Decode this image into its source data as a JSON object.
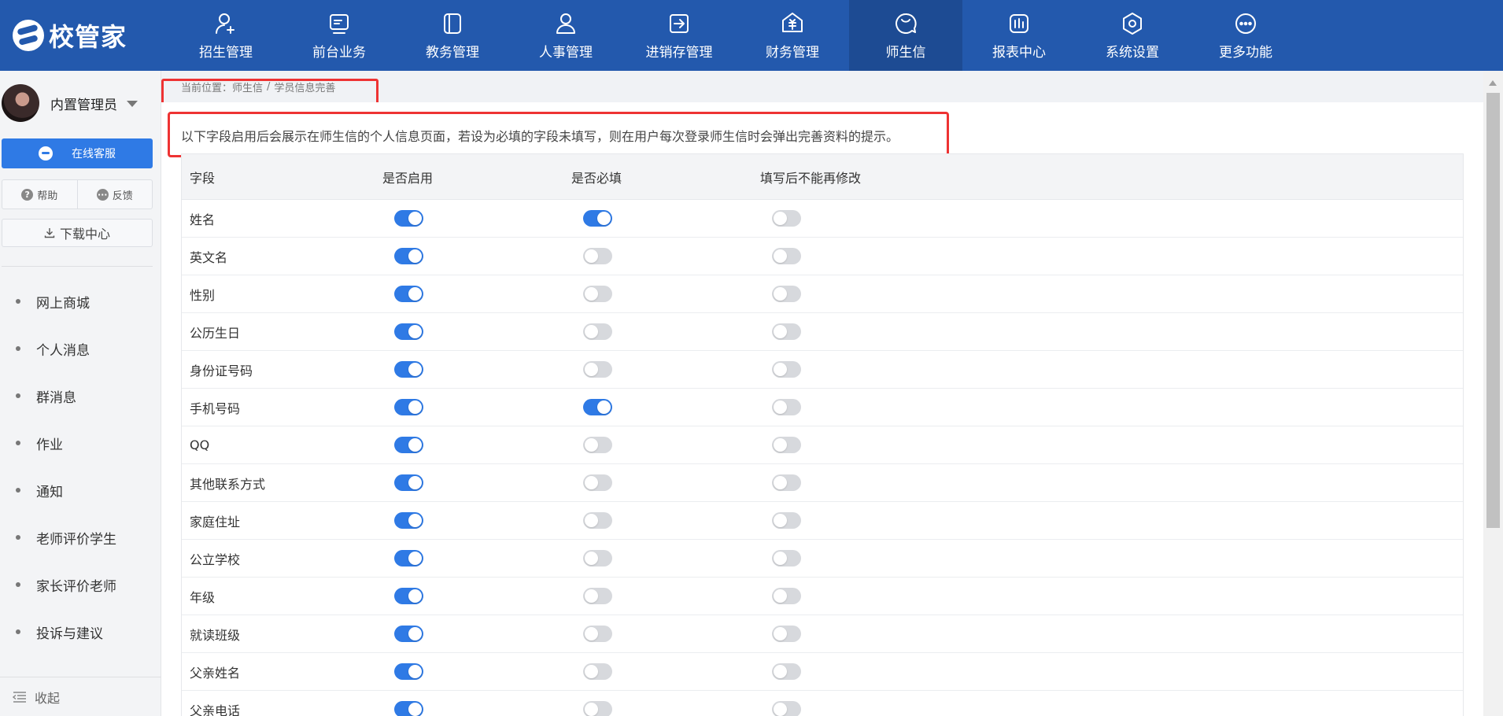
{
  "app": {
    "logo_text": "校管家"
  },
  "nav": [
    {
      "label": "招生管理",
      "icon": "user-add-icon"
    },
    {
      "label": "前台业务",
      "icon": "desk-icon"
    },
    {
      "label": "教务管理",
      "icon": "book-icon"
    },
    {
      "label": "人事管理",
      "icon": "person-icon"
    },
    {
      "label": "进销存管理",
      "icon": "inventory-icon"
    },
    {
      "label": "财务管理",
      "icon": "finance-icon"
    },
    {
      "label": "师生信",
      "icon": "chat-icon",
      "active": true
    },
    {
      "label": "报表中心",
      "icon": "report-icon"
    },
    {
      "label": "系统设置",
      "icon": "settings-icon"
    },
    {
      "label": "更多功能",
      "icon": "more-icon"
    }
  ],
  "sidebar": {
    "user_name": "内置管理员",
    "service_label": "在线客服",
    "help_label": "帮助",
    "feedback_label": "反馈",
    "download_label": "下载中心",
    "menu": [
      "网上商城",
      "个人消息",
      "群消息",
      "作业",
      "通知",
      "老师评价学生",
      "家长评价老师",
      "投诉与建议"
    ],
    "collapse_label": "收起"
  },
  "breadcrumb": {
    "prefix": "当前位置：",
    "section": "师生信",
    "separator": "/",
    "page": "学员信息完善"
  },
  "notice": "以下字段启用后会展示在师生信的个人信息页面，若设为必填的字段未填写，则在用户每次登录师生信时会弹出完善资料的提示。",
  "table": {
    "headers": {
      "field": "字段",
      "enabled": "是否启用",
      "required": "是否必填",
      "locked": "填写后不能再修改"
    },
    "rows": [
      {
        "field": "姓名",
        "enabled": true,
        "required": true,
        "locked": false
      },
      {
        "field": "英文名",
        "enabled": true,
        "required": false,
        "locked": false
      },
      {
        "field": "性别",
        "enabled": true,
        "required": false,
        "locked": false
      },
      {
        "field": "公历生日",
        "enabled": true,
        "required": false,
        "locked": false
      },
      {
        "field": "身份证号码",
        "enabled": true,
        "required": false,
        "locked": false
      },
      {
        "field": "手机号码",
        "enabled": true,
        "required": true,
        "locked": false
      },
      {
        "field": "QQ",
        "enabled": true,
        "required": false,
        "locked": false
      },
      {
        "field": "其他联系方式",
        "enabled": true,
        "required": false,
        "locked": false
      },
      {
        "field": "家庭住址",
        "enabled": true,
        "required": false,
        "locked": false
      },
      {
        "field": "公立学校",
        "enabled": true,
        "required": false,
        "locked": false
      },
      {
        "field": "年级",
        "enabled": true,
        "required": false,
        "locked": false
      },
      {
        "field": "就读班级",
        "enabled": true,
        "required": false,
        "locked": false
      },
      {
        "field": "父亲姓名",
        "enabled": true,
        "required": false,
        "locked": false
      },
      {
        "field": "父亲电话",
        "enabled": true,
        "required": false,
        "locked": false
      }
    ]
  },
  "colors": {
    "nav_bg": "#2359ad",
    "nav_active": "#1d4b93",
    "accent": "#2f7ae5",
    "highlight": "#ee3333"
  }
}
